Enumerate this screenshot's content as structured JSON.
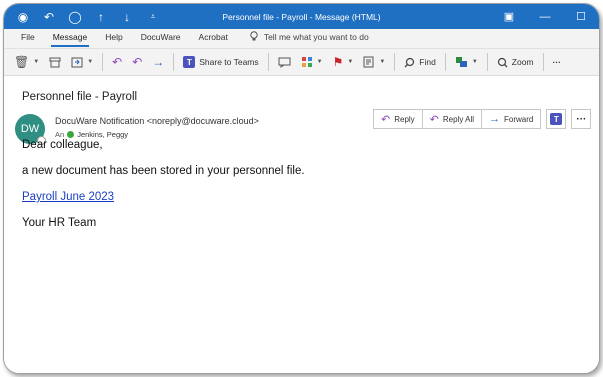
{
  "window": {
    "title": "Personnel file - Payroll  -  Message (HTML)",
    "controls": {
      "restore": "▣",
      "minimize": "—",
      "maximize": "☐"
    }
  },
  "quick_access": {
    "icons": [
      "save-icon",
      "undo-icon",
      "circle-icon",
      "up-arrow-icon",
      "down-arrow-icon",
      "customize-icon"
    ],
    "glyphs": {
      "save": "◉",
      "undo": "↶",
      "circle": "◯",
      "up": "↑",
      "down": "↓",
      "customize": "⩡"
    }
  },
  "menu": {
    "tabs": [
      "File",
      "Message",
      "Help",
      "DocuWare",
      "Acrobat"
    ],
    "active_tab": "Message",
    "tell_me": "Tell me what you want to do"
  },
  "ribbon": {
    "share_to_teams": "Share to Teams",
    "find": "Find",
    "zoom": "Zoom",
    "more": "···"
  },
  "message": {
    "subject": "Personnel file - Payroll",
    "avatar_initials": "DW",
    "avatar_color": "#2f8f83",
    "sender": "DocuWare Notification <noreply@docuware.cloud>",
    "to_label": "An",
    "to_name": "Jenkins, Peggy",
    "actions": {
      "reply": "Reply",
      "reply_all": "Reply All",
      "forward": "Forward",
      "more": "···"
    },
    "body": {
      "greeting": "Dear colleague,",
      "text": "a new document has been stored in your personnel file.",
      "link": "Payroll June 2023",
      "signature": "Your HR Team"
    }
  },
  "colors": {
    "titlebar": "#1f6fc2",
    "link": "#1a3fc4",
    "accent": "#8b4ab8"
  }
}
